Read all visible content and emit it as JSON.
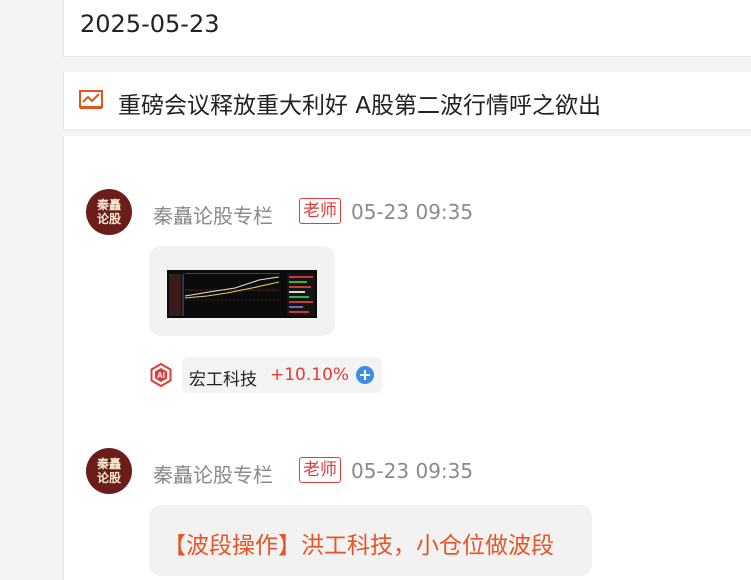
{
  "date_header": {
    "date": "2025-05-23"
  },
  "topic": {
    "icon": "trend-chart-icon",
    "title": "重磅会议释放重大利好 A股第二波行情呼之欲出"
  },
  "posts": [
    {
      "avatar_text": [
        "秦矗",
        "论股"
      ],
      "author": "秦矗论股专栏",
      "role_badge": "老师",
      "time": "05-23 09:35",
      "image": "stock-chart-screenshot",
      "stock_tag": {
        "ai_icon": "ai-icon",
        "name": "宏工科技",
        "change": "+10.10%",
        "add_icon": "add-circle-icon"
      }
    },
    {
      "avatar_text": [
        "秦矗",
        "论股"
      ],
      "author": "秦矗论股专栏",
      "role_badge": "老师",
      "time": "05-23 09:35",
      "message": "【波段操作】洪工科技，小仓位做波段"
    }
  ],
  "colors": {
    "accent_red": "#e23b3b",
    "message_orange": "#e85427",
    "avatar_bg": "#6b1d1a"
  }
}
